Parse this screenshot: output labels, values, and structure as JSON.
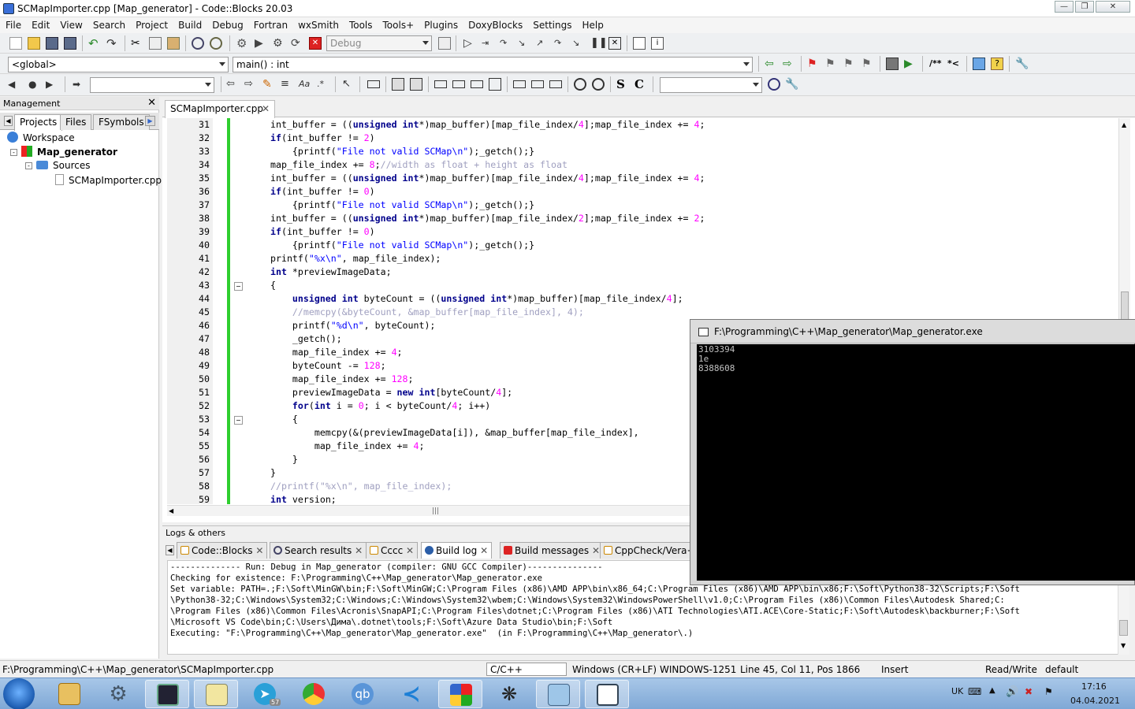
{
  "window": {
    "title": "SCMapImporter.cpp [Map_generator] - Code::Blocks 20.03"
  },
  "menu": [
    "File",
    "Edit",
    "View",
    "Search",
    "Project",
    "Build",
    "Debug",
    "Fortran",
    "wxSmith",
    "Tools",
    "Tools+",
    "Plugins",
    "DoxyBlocks",
    "Settings",
    "Help"
  ],
  "toolbar": {
    "build_target": "Debug",
    "scope": "<global>",
    "function": "main() : int",
    "bold_s": "S",
    "bold_c": "C",
    "doxy_block": "/**",
    "doxy_line": "*<"
  },
  "management": {
    "title": "Management",
    "tabs": [
      "Projects",
      "Files",
      "FSymbols"
    ],
    "tree": {
      "workspace": "Workspace",
      "project": "Map_generator",
      "folder": "Sources",
      "file": "SCMapImporter.cpp"
    }
  },
  "editor": {
    "tab": "SCMapImporter.cpp",
    "lines": [
      {
        "n": "31",
        "html": "int_buffer = ((<k>unsigned</k> <k>int</k>*)map_buffer)[map_file_index/<n>4</n>];map_file_index += <n>4</n>;"
      },
      {
        "n": "32",
        "html": "<k>if</k>(int_buffer != <n>2</n>)"
      },
      {
        "n": "33",
        "html": "    {printf(<s>\"File not valid SCMap\\n\"</s>);_getch();}"
      },
      {
        "n": "34",
        "html": "map_file_index += <n>8</n>;<c>//width as float + height as float</c>"
      },
      {
        "n": "35",
        "html": "int_buffer = ((<k>unsigned</k> <k>int</k>*)map_buffer)[map_file_index/<n>4</n>];map_file_index += <n>4</n>;"
      },
      {
        "n": "36",
        "html": "<k>if</k>(int_buffer != <n>0</n>)"
      },
      {
        "n": "37",
        "html": "    {printf(<s>\"File not valid SCMap\\n\"</s>);_getch();}"
      },
      {
        "n": "38",
        "html": "int_buffer = ((<k>unsigned</k> <k>int</k>*)map_buffer)[map_file_index/<n>2</n>];map_file_index += <n>2</n>;"
      },
      {
        "n": "39",
        "html": "<k>if</k>(int_buffer != <n>0</n>)"
      },
      {
        "n": "40",
        "html": "    {printf(<s>\"File not valid SCMap\\n\"</s>);_getch();}"
      },
      {
        "n": "41",
        "html": "printf(<s>\"%x\\n\"</s>, map_file_index);"
      },
      {
        "n": "42",
        "html": "<k>int</k> *previewImageData;"
      },
      {
        "n": "43",
        "html": "{"
      },
      {
        "n": "44",
        "html": "    <k>unsigned</k> <k>int</k> byteCount = ((<k>unsigned</k> <k>int</k>*)map_buffer)[map_file_index/<n>4</n>];"
      },
      {
        "n": "45",
        "html": "    <c>//memcpy(&byteCount, &map_buffer[map_file_index], 4);</c>"
      },
      {
        "n": "46",
        "html": "    printf(<s>\"%d\\n\"</s>, byteCount);"
      },
      {
        "n": "47",
        "html": "    _getch();"
      },
      {
        "n": "48",
        "html": "    map_file_index += <n>4</n>;"
      },
      {
        "n": "49",
        "html": "    byteCount -= <n>128</n>;"
      },
      {
        "n": "50",
        "html": "    map_file_index += <n>128</n>;"
      },
      {
        "n": "51",
        "html": "    previewImageData = <k>new</k> <k>int</k>[byteCount/<n>4</n>];"
      },
      {
        "n": "52",
        "html": "    <k>for</k>(<k>int</k> i = <n>0</n>; i < byteCount/<n>4</n>; i++)"
      },
      {
        "n": "53",
        "html": "    {"
      },
      {
        "n": "54",
        "html": "        memcpy(&(previewImageData[i]), &map_buffer[map_file_index],"
      },
      {
        "n": "55",
        "html": "        map_file_index += <n>4</n>;"
      },
      {
        "n": "56",
        "html": "    }"
      },
      {
        "n": "57",
        "html": "}"
      },
      {
        "n": "58",
        "html": "<c>//printf(\"%x\\n\", map_file_index);</c>"
      },
      {
        "n": "59",
        "html": "<k>int</k> version;"
      }
    ]
  },
  "logs": {
    "title": "Logs & others",
    "tabs": [
      "Code::Blocks",
      "Search results",
      "Cccc",
      "Build log",
      "Build messages",
      "CppCheck/Vera+"
    ],
    "lines": [
      "-------------- Run: Debug in Map_generator (compiler: GNU GCC Compiler)---------------",
      "",
      "Checking for existence: F:\\Programming\\C++\\Map_generator\\Map_generator.exe",
      "Set variable: PATH=.;F:\\Soft\\MinGW\\bin;F:\\Soft\\MinGW;C:\\Program Files (x86)\\AMD APP\\bin\\x86_64;C:\\Program Files (x86)\\AMD APP\\bin\\x86;F:\\Soft\\Python38-32\\Scripts;F:\\Soft",
      "\\Python38-32;C:\\Windows\\System32;C:\\Windows;C:\\Windows\\System32\\wbem;C:\\Windows\\System32\\WindowsPowerShell\\v1.0;C:\\Program Files (x86)\\Common Files\\Autodesk Shared;C:",
      "\\Program Files (x86)\\Common Files\\Acronis\\SnapAPI;C:\\Program Files\\dotnet;C:\\Program Files (x86)\\ATI Technologies\\ATI.ACE\\Core-Static;F:\\Soft\\Autodesk\\backburner;F:\\Soft",
      "\\Microsoft VS Code\\bin;C:\\Users\\Дима\\.dotnet\\tools;F:\\Soft\\Azure Data Studio\\bin;F:\\Soft",
      "Executing: \"F:\\Programming\\C++\\Map_generator\\Map_generator.exe\"  (in F:\\Programming\\C++\\Map_generator\\.)"
    ]
  },
  "console": {
    "title": "F:\\Programming\\C++\\Map_generator\\Map_generator.exe",
    "output": [
      "3103394",
      "1e",
      "8388608"
    ]
  },
  "status": {
    "path": "F:\\Programming\\C++\\Map_generator\\SCMapImporter.cpp",
    "lang": "C/C++",
    "eol": "Windows (CR+LF)",
    "encoding": "WINDOWS-1251",
    "position": "Line 45, Col 11, Pos 1866",
    "mode": "Insert",
    "access": "Read/Write",
    "profile": "default"
  },
  "taskbar": {
    "lang": "UK",
    "time": "17:16",
    "date": "04.04.2021",
    "telegram_badge": "57",
    "qb_label": "qb"
  }
}
